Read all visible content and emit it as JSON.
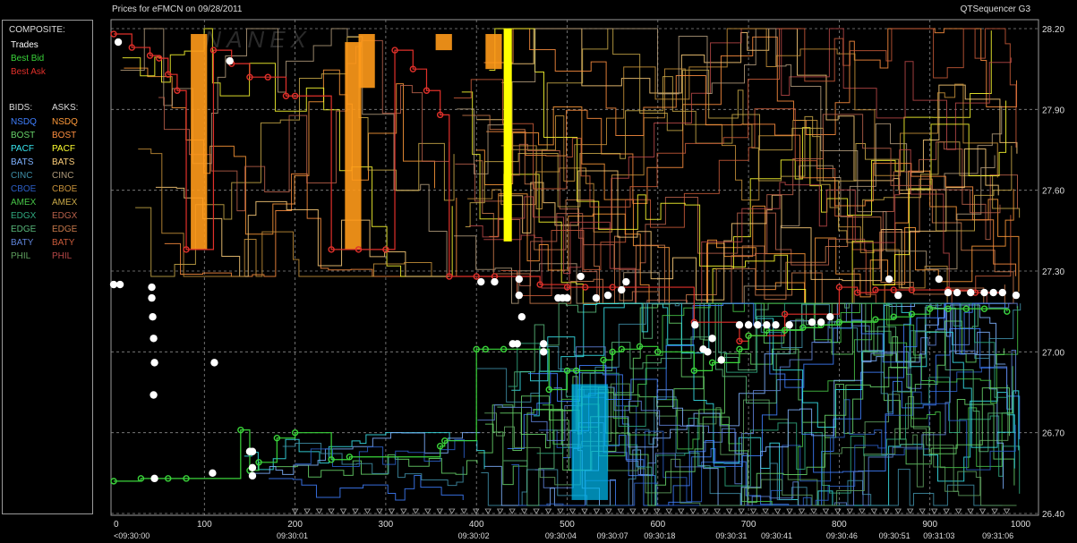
{
  "title": "Prices for  eFMCN  on  09/28/2011",
  "subtitle": "QTSequencer G3",
  "watermark": "NANEX",
  "legend": {
    "composite_heading": "COMPOSITE:",
    "composite": [
      {
        "label": "Trades",
        "color": "#ffffff"
      },
      {
        "label": "Best Bid",
        "color": "#3ad43a"
      },
      {
        "label": "Best Ask",
        "color": "#e0302a"
      }
    ],
    "bids_heading": "BIDS:",
    "asks_heading": "ASKS:",
    "bids": [
      {
        "label": "NSDQ",
        "color": "#3f7fff"
      },
      {
        "label": "BOST",
        "color": "#67d36a"
      },
      {
        "label": "PACF",
        "color": "#38e6f0"
      },
      {
        "label": "BATS",
        "color": "#7fb2ff"
      },
      {
        "label": "CINC",
        "color": "#3f8fa8"
      },
      {
        "label": "CBOE",
        "color": "#2c5fc8"
      },
      {
        "label": "AMEX",
        "color": "#47c447"
      },
      {
        "label": "EDGX",
        "color": "#2fa87f"
      },
      {
        "label": "EDGE",
        "color": "#58b87a"
      },
      {
        "label": "BATY",
        "color": "#5f83d8"
      },
      {
        "label": "PHIL",
        "color": "#5fa05f"
      }
    ],
    "asks": [
      {
        "label": "NSDQ",
        "color": "#ff9a3a"
      },
      {
        "label": "BOST",
        "color": "#ff8f40"
      },
      {
        "label": "PACF",
        "color": "#ffff30"
      },
      {
        "label": "BATS",
        "color": "#ffcf7a"
      },
      {
        "label": "CINC",
        "color": "#b09a7a"
      },
      {
        "label": "CBOE",
        "color": "#c8923a"
      },
      {
        "label": "AMEX",
        "color": "#c8a848"
      },
      {
        "label": "EDGX",
        "color": "#b8604a"
      },
      {
        "label": "EDGE",
        "color": "#c8784a"
      },
      {
        "label": "BATY",
        "color": "#c85a3a"
      },
      {
        "label": "PHIL",
        "color": "#b84848"
      }
    ]
  },
  "chart_data": {
    "type": "line",
    "y_ticks": [
      "28.20",
      "27.90",
      "27.60",
      "27.30",
      "27.00",
      "26.70",
      "26.40"
    ],
    "ylim": [
      26.4,
      28.2
    ],
    "xlim": [
      0,
      1000
    ],
    "x_ticks": [
      "0",
      "100",
      "200",
      "300",
      "400",
      "500",
      "600",
      "700",
      "800",
      "900",
      "1000"
    ],
    "x_time_labels": [
      {
        "x": 0,
        "label": "<09:30:00"
      },
      {
        "x": 197,
        "label": "09:30:01"
      },
      {
        "x": 397,
        "label": "09:30:02"
      },
      {
        "x": 493,
        "label": "09:30:04"
      },
      {
        "x": 550,
        "label": "09:30:07"
      },
      {
        "x": 602,
        "label": "09:30:18"
      },
      {
        "x": 681,
        "label": "09:30:31"
      },
      {
        "x": 731,
        "label": "09:30:41"
      },
      {
        "x": 803,
        "label": "09:30:46"
      },
      {
        "x": 861,
        "label": "09:30:51"
      },
      {
        "x": 910,
        "label": "09:31:03"
      },
      {
        "x": 975,
        "label": "09:31:06"
      }
    ],
    "grid": true,
    "trades": [
      [
        5,
        28.15
      ],
      [
        128,
        28.08
      ],
      [
        0,
        27.25
      ],
      [
        7,
        27.25
      ],
      [
        42,
        27.24
      ],
      [
        42,
        27.2
      ],
      [
        43,
        27.13
      ],
      [
        44,
        27.05
      ],
      [
        45,
        26.96
      ],
      [
        111,
        26.96
      ],
      [
        44,
        26.84
      ],
      [
        150,
        26.63
      ],
      [
        153,
        26.63
      ],
      [
        153,
        26.57
      ],
      [
        153,
        26.54
      ],
      [
        109,
        26.55
      ],
      [
        45,
        26.53
      ],
      [
        405,
        27.26
      ],
      [
        420,
        27.26
      ],
      [
        447,
        27.27
      ],
      [
        447,
        27.21
      ],
      [
        450,
        27.13
      ],
      [
        490,
        27.2
      ],
      [
        495,
        27.2
      ],
      [
        500,
        27.2
      ],
      [
        515,
        27.28
      ],
      [
        532,
        27.2
      ],
      [
        545,
        27.21
      ],
      [
        565,
        27.26
      ],
      [
        560,
        27.23
      ],
      [
        445,
        27.03
      ],
      [
        440,
        27.03
      ],
      [
        474,
        27.03
      ],
      [
        474,
        27.0
      ],
      [
        641,
        27.1
      ],
      [
        660,
        27.05
      ],
      [
        650,
        27.01
      ],
      [
        655,
        27.0
      ],
      [
        670,
        26.97
      ],
      [
        690,
        27.1
      ],
      [
        700,
        27.1
      ],
      [
        710,
        27.1
      ],
      [
        720,
        27.1
      ],
      [
        730,
        27.1
      ],
      [
        745,
        27.1
      ],
      [
        770,
        27.11
      ],
      [
        780,
        27.11
      ],
      [
        790,
        27.13
      ],
      [
        855,
        27.27
      ],
      [
        865,
        27.21
      ],
      [
        910,
        27.27
      ],
      [
        920,
        27.22
      ],
      [
        930,
        27.22
      ],
      [
        945,
        27.22
      ],
      [
        960,
        27.22
      ],
      [
        970,
        27.22
      ],
      [
        980,
        27.22
      ],
      [
        995,
        27.21
      ]
    ],
    "best_bid": [
      [
        0,
        26.52
      ],
      [
        30,
        26.53
      ],
      [
        60,
        26.53
      ],
      [
        80,
        26.53
      ],
      [
        140,
        26.71
      ],
      [
        150,
        26.56
      ],
      [
        160,
        26.59
      ],
      [
        180,
        26.68
      ],
      [
        200,
        26.7
      ],
      [
        240,
        26.6
      ],
      [
        260,
        26.61
      ],
      [
        360,
        26.65
      ],
      [
        365,
        26.67
      ],
      [
        400,
        27.01
      ],
      [
        410,
        27.01
      ],
      [
        430,
        27.01
      ],
      [
        480,
        26.86
      ],
      [
        500,
        26.93
      ],
      [
        510,
        26.93
      ],
      [
        540,
        26.97
      ],
      [
        550,
        27.0
      ],
      [
        560,
        27.01
      ],
      [
        580,
        27.02
      ],
      [
        600,
        27.0
      ],
      [
        640,
        26.93
      ],
      [
        660,
        26.96
      ],
      [
        690,
        27.01
      ],
      [
        700,
        27.06
      ],
      [
        720,
        27.08
      ],
      [
        740,
        27.08
      ],
      [
        760,
        27.09
      ],
      [
        780,
        27.1
      ],
      [
        800,
        27.11
      ],
      [
        840,
        27.12
      ],
      [
        860,
        27.13
      ],
      [
        880,
        27.14
      ],
      [
        900,
        27.16
      ],
      [
        920,
        27.16
      ],
      [
        940,
        27.16
      ],
      [
        960,
        27.16
      ],
      [
        985,
        27.15
      ]
    ],
    "best_ask": [
      [
        0,
        28.18
      ],
      [
        20,
        28.13
      ],
      [
        40,
        28.1
      ],
      [
        50,
        28.09
      ],
      [
        60,
        28.03
      ],
      [
        70,
        27.97
      ],
      [
        80,
        27.38
      ],
      [
        110,
        28.12
      ],
      [
        130,
        28.07
      ],
      [
        150,
        28.02
      ],
      [
        170,
        28.02
      ],
      [
        190,
        27.95
      ],
      [
        200,
        27.95
      ],
      [
        240,
        27.38
      ],
      [
        270,
        27.38
      ],
      [
        300,
        27.38
      ],
      [
        310,
        28.12
      ],
      [
        330,
        28.05
      ],
      [
        345,
        27.97
      ],
      [
        360,
        27.88
      ],
      [
        370,
        27.28
      ],
      [
        400,
        27.28
      ],
      [
        420,
        27.28
      ],
      [
        470,
        27.25
      ],
      [
        500,
        27.24
      ],
      [
        520,
        27.24
      ],
      [
        550,
        27.24
      ],
      [
        640,
        27.11
      ],
      [
        690,
        27.04
      ],
      [
        700,
        27.06
      ],
      [
        740,
        27.14
      ],
      [
        800,
        27.24
      ],
      [
        820,
        27.22
      ],
      [
        840,
        27.23
      ],
      [
        860,
        27.23
      ],
      [
        880,
        27.23
      ],
      [
        920,
        27.23
      ],
      [
        950,
        27.22
      ],
      [
        980,
        27.22
      ]
    ]
  }
}
